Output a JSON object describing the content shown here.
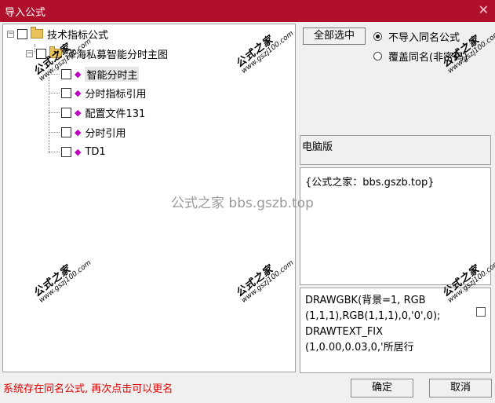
{
  "window": {
    "title": "导入公式",
    "close_glyph": "✕"
  },
  "tree": {
    "root": "技术指标公式",
    "group": "泽海私募智能分时主图",
    "items": [
      "智能分时主",
      "分时指标引用",
      "配置文件131",
      "分时引用",
      "TD1"
    ]
  },
  "options": {
    "select_all": "全部选中",
    "radio_no_import": "不导入同名公式",
    "radio_overwrite": "覆盖同名(非密码)"
  },
  "panels": {
    "computer_version": "电脑版",
    "description": "{公式之家：bbs.gszb.top}",
    "code_lines": [
      "DRAWGBK(背景=1, RGB",
      "(1,1,1),RGB(1,1,1),0,'0',0);",
      "DRAWTEXT_FIX",
      "(1,0.00,0.03,0,'所居行"
    ]
  },
  "watermark": {
    "center": "公式之家 bbs.gszb.top",
    "stamp_cn": "公式之家",
    "stamp_url": "www.gszj100.com"
  },
  "status": "系统存在同名公式, 再次点击可以更名",
  "buttons": {
    "ok": "确定",
    "cancel": "取消"
  }
}
